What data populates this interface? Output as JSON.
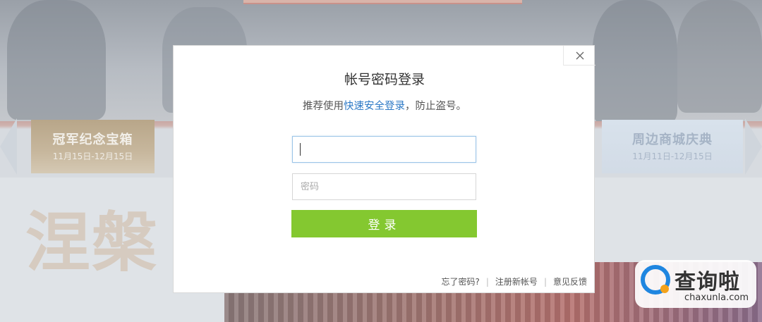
{
  "background": {
    "promo_left": {
      "title": "冠军纪念宝箱",
      "date": "11月15日-12月15日"
    },
    "promo_right": {
      "title": "周边商城庆典",
      "date": "11月11日-12月15日"
    },
    "big_text": "涅槃"
  },
  "dialog": {
    "title": "帐号密码登录",
    "subtitle_prefix": "推荐使用",
    "subtitle_link": "快速安全登录",
    "subtitle_suffix": "，防止盗号。",
    "account_value": "",
    "password_placeholder": "密码",
    "login_label": "登录",
    "footer": {
      "forgot_password": "忘了密码?",
      "register": "注册新帐号",
      "feedback": "意见反馈",
      "separator": "|"
    }
  },
  "watermark": {
    "brand_cn": "查询啦",
    "brand_en": "chaxunla.com"
  },
  "colors": {
    "accent_link": "#2b78c5",
    "login_button": "#84c830",
    "watermark_blue": "#1f86e0",
    "watermark_orange": "#f3a21b"
  },
  "icons": {
    "close": "close-icon"
  }
}
